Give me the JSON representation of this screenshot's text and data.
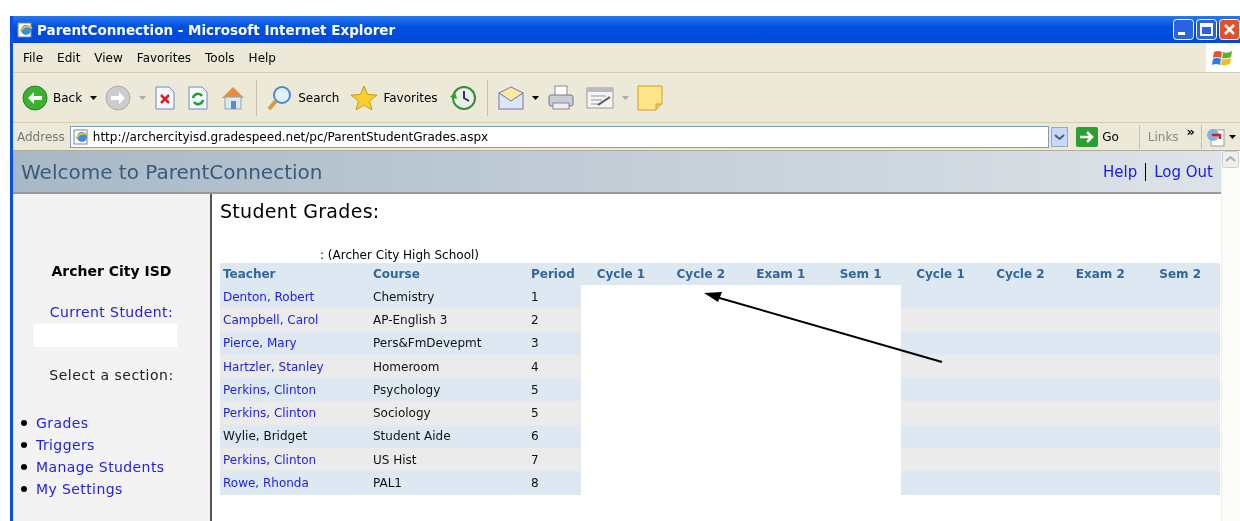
{
  "window": {
    "title": "ParentConnection - Microsoft Internet Explorer"
  },
  "menu": [
    "File",
    "Edit",
    "View",
    "Favorites",
    "Tools",
    "Help"
  ],
  "toolbar": [
    [
      {
        "kind": "back",
        "label": "Back",
        "dropdown": true
      },
      {
        "kind": "forward",
        "dropdown": true
      },
      {
        "kind": "stop",
        "dropdown": false
      },
      {
        "kind": "refresh",
        "dropdown": false
      },
      {
        "kind": "home",
        "dropdown": false
      }
    ],
    [
      {
        "kind": "search",
        "label": "Search",
        "dropdown": false
      },
      {
        "kind": "favorites",
        "label": "Favorites",
        "dropdown": false
      },
      {
        "kind": "history",
        "dropdown": false
      }
    ],
    [
      {
        "kind": "mail",
        "dropdown": true
      },
      {
        "kind": "print",
        "dropdown": false
      },
      {
        "kind": "edit",
        "dropdown": true
      },
      {
        "kind": "note",
        "dropdown": false
      }
    ]
  ],
  "address_bar": {
    "label": "Address",
    "url": "http://archercityisd.gradespeed.net/pc/ParentStudentGrades.aspx",
    "go": "Go",
    "links": "Links",
    "more": "»"
  },
  "page": {
    "banner": "Welcome to ParentConnection",
    "header_links": [
      "Help",
      "Log Out"
    ],
    "sidebar": {
      "district": "Archer City ISD",
      "current_student_label": "Current Student:",
      "section_prompt": "Select a section:",
      "sections": [
        "Grades",
        "Triggers",
        "Manage Students",
        "My Settings"
      ]
    },
    "heading": "Student Grades:",
    "school": ": (Archer City High School)",
    "table": {
      "columns": [
        {
          "label": "Teacher"
        },
        {
          "label": "Course"
        },
        {
          "label": "Period"
        },
        {
          "label": "Cycle 1",
          "blanked": true
        },
        {
          "label": "Cycle 2",
          "blanked": true
        },
        {
          "label": "Exam 1",
          "blanked": true
        },
        {
          "label": "Sem 1",
          "blanked": true
        },
        {
          "label": "Cycle 1",
          "blanked": false
        },
        {
          "label": "Cycle 2",
          "blanked": false
        },
        {
          "label": "Exam 2",
          "blanked": false
        },
        {
          "label": "Sem 2",
          "blanked": false
        }
      ],
      "rows": [
        {
          "teacher": "Denton, Robert",
          "link": true,
          "course": "Chemistry",
          "period": "1"
        },
        {
          "teacher": "Campbell, Carol",
          "link": true,
          "course": "AP-English 3",
          "period": "2"
        },
        {
          "teacher": "Pierce, Mary",
          "link": true,
          "course": "Pers&FmDevepmt",
          "period": "3"
        },
        {
          "teacher": "Hartzler, Stanley",
          "link": true,
          "course": "Homeroom",
          "period": "4"
        },
        {
          "teacher": "Perkins, Clinton",
          "link": true,
          "course": "Psychology",
          "period": "5"
        },
        {
          "teacher": "Perkins, Clinton",
          "link": true,
          "course": "Sociology",
          "period": "5"
        },
        {
          "teacher": "Wylie, Bridget",
          "link": false,
          "course": "Student Aide",
          "period": "6"
        },
        {
          "teacher": "Perkins, Clinton",
          "link": true,
          "course": "US Hist",
          "period": "7"
        },
        {
          "teacher": "Rowe, Rhonda",
          "link": true,
          "course": "PAL1",
          "period": "8"
        }
      ]
    },
    "annotations": [
      {
        "kind": "arrow"
      }
    ]
  }
}
